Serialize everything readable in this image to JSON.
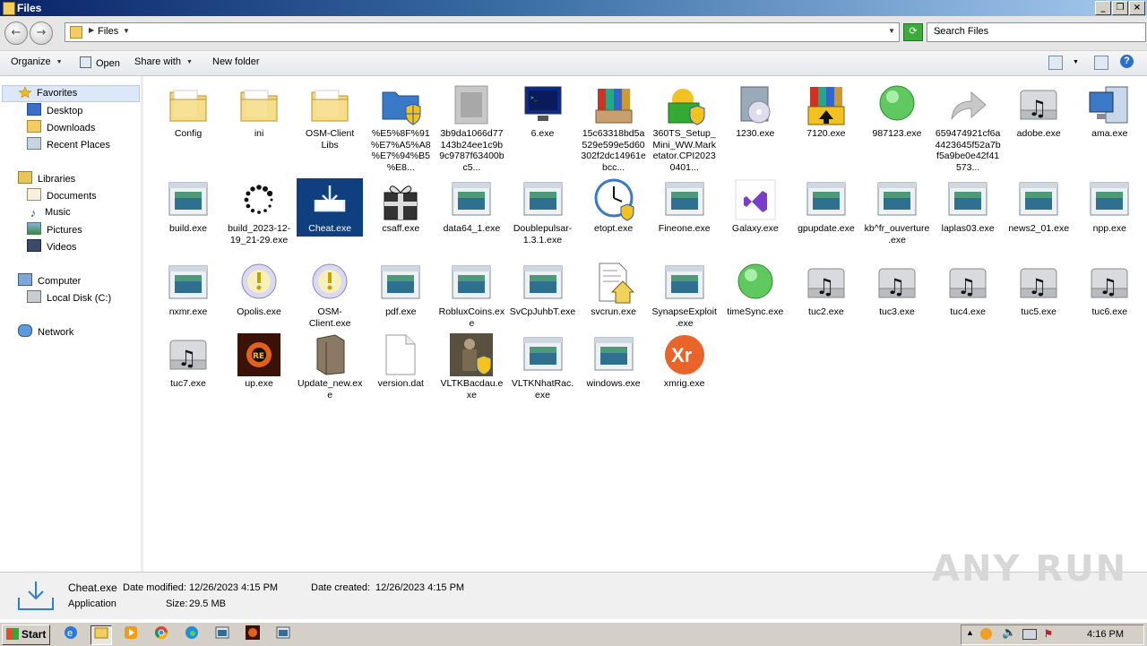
{
  "window": {
    "title": "Files"
  },
  "address": {
    "crumb": "Files",
    "search_placeholder": "Search Files"
  },
  "toolbar": {
    "organize": "Organize",
    "open": "Open",
    "share_with": "Share with",
    "new_folder": "New folder"
  },
  "nav": {
    "favorites": "Favorites",
    "desktop": "Desktop",
    "downloads": "Downloads",
    "recent_places": "Recent Places",
    "libraries": "Libraries",
    "documents": "Documents",
    "music": "Music",
    "pictures": "Pictures",
    "videos": "Videos",
    "computer": "Computer",
    "local_disk": "Local Disk (C:)",
    "network": "Network"
  },
  "files": [
    {
      "label": "Config",
      "icon": "folder-icon"
    },
    {
      "label": "ini",
      "icon": "folder-icon"
    },
    {
      "label": "OSM-Client Libs",
      "icon": "folder-icon"
    },
    {
      "label": "%E5%8F%91%E7%A5%A8%E7%94%B5%E8...",
      "icon": "shield-folder-icon"
    },
    {
      "label": "3b9da1066d77143b24ee1c9b9c9787f63400bc5...",
      "icon": "blurred-app-icon"
    },
    {
      "label": "6.exe",
      "icon": "terminal-icon"
    },
    {
      "label": "15c63318bd5a529e599e5d60302f2dc14961ebcc...",
      "icon": "winrar-icon"
    },
    {
      "label": "360TS_Setup_Mini_WW.Marketator.CPI20230401...",
      "icon": "360-setup-icon"
    },
    {
      "label": "1230.exe",
      "icon": "disc-installer-icon"
    },
    {
      "label": "7120.exe",
      "icon": "winrar-sfx-icon"
    },
    {
      "label": "987123.exe",
      "icon": "green-orb-icon"
    },
    {
      "label": "659474921cf6a4423645f52a7bf5a9be0e42f41573...",
      "icon": "shortcut-arrow-icon"
    },
    {
      "label": "adobe.exe",
      "icon": "music-drive-icon"
    },
    {
      "label": "ama.exe",
      "icon": "computer-icon"
    },
    {
      "label": "build.exe",
      "icon": "app-window-icon"
    },
    {
      "label": "build_2023-12-19_21-29.exe",
      "icon": "spinner-icon"
    },
    {
      "label": "Cheat.exe",
      "icon": "download-tray-icon"
    },
    {
      "label": "csaff.exe",
      "icon": "gift-icon"
    },
    {
      "label": "data64_1.exe",
      "icon": "app-window-icon"
    },
    {
      "label": "Doublepulsar-1.3.1.exe",
      "icon": "app-window-icon"
    },
    {
      "label": "etopt.exe",
      "icon": "clock-icon"
    },
    {
      "label": "Fineone.exe",
      "icon": "app-window-icon"
    },
    {
      "label": "Galaxy.exe",
      "icon": "visual-studio-icon"
    },
    {
      "label": "gpupdate.exe",
      "icon": "app-window-icon"
    },
    {
      "label": "kb^fr_ouverture.exe",
      "icon": "app-window-icon"
    },
    {
      "label": "laplas03.exe",
      "icon": "app-window-icon"
    },
    {
      "label": "news2_01.exe",
      "icon": "app-window-icon"
    },
    {
      "label": "npp.exe",
      "icon": "app-window-icon"
    },
    {
      "label": "nxmr.exe",
      "icon": "app-window-icon"
    },
    {
      "label": "Opolis.exe",
      "icon": "warning-orb-icon"
    },
    {
      "label": "OSM-Client.exe",
      "icon": "warning-orb-icon"
    },
    {
      "label": "pdf.exe",
      "icon": "app-window-icon"
    },
    {
      "label": "RobluxCoins.exe",
      "icon": "app-window-icon"
    },
    {
      "label": "SvCpJuhbT.exe",
      "icon": "app-window-icon"
    },
    {
      "label": "svcrun.exe",
      "icon": "house-doc-icon"
    },
    {
      "label": "SynapseExploit.exe",
      "icon": "app-window-icon"
    },
    {
      "label": "timeSync.exe",
      "icon": "green-orb-icon"
    },
    {
      "label": "tuc2.exe",
      "icon": "music-drive-icon"
    },
    {
      "label": "tuc3.exe",
      "icon": "music-drive-icon"
    },
    {
      "label": "tuc4.exe",
      "icon": "music-drive-icon"
    },
    {
      "label": "tuc5.exe",
      "icon": "music-drive-icon"
    },
    {
      "label": "tuc6.exe",
      "icon": "music-drive-icon"
    },
    {
      "label": "tuc7.exe",
      "icon": "music-drive-icon"
    },
    {
      "label": "up.exe",
      "icon": "game-logo-icon"
    },
    {
      "label": "Update_new.exe",
      "icon": "box-icon"
    },
    {
      "label": "version.dat",
      "icon": "blank-doc-icon"
    },
    {
      "label": "VLTKBacdau.exe",
      "icon": "warrior-shield-icon"
    },
    {
      "label": "VLTKNhatRac.exe",
      "icon": "app-window-icon"
    },
    {
      "label": "windows.exe",
      "icon": "app-window-icon"
    },
    {
      "label": "xmrig.exe",
      "icon": "xmrig-icon"
    }
  ],
  "selected_file": "Cheat.exe",
  "details": {
    "name": "Cheat.exe",
    "type": "Application",
    "date_modified_label": "Date modified:",
    "date_modified": "12/26/2023 4:15 PM",
    "date_created_label": "Date created:",
    "date_created": "12/26/2023 4:15 PM",
    "size_label": "Size:",
    "size": "29.5 MB"
  },
  "watermark": "ANY RUN",
  "taskbar": {
    "start": "Start",
    "clock": "4:16 PM"
  },
  "colors": {
    "selection": "#0f3f7f",
    "titlebar": "#0a246a"
  }
}
